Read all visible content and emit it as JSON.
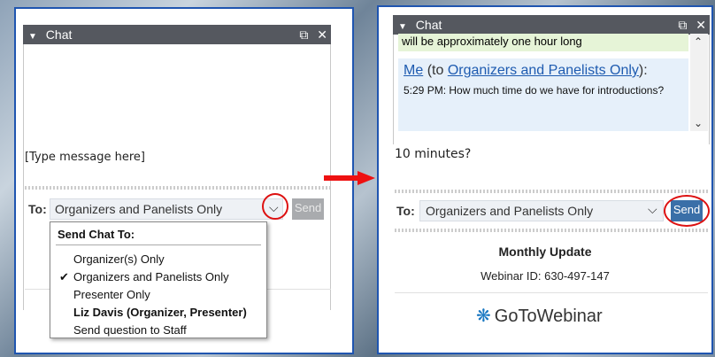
{
  "left_panel": {
    "title": "Chat",
    "message_placeholder": "[Type message here]",
    "to_label": "To:",
    "recipient_selected": "Organizers and Panelists Only",
    "send_label": "Send",
    "dropdown": {
      "header": "Send Chat To:",
      "items": [
        {
          "label": "Organizer(s) Only",
          "checked": false,
          "bold": false
        },
        {
          "label": "Organizers and Panelists Only",
          "checked": true,
          "bold": false
        },
        {
          "label": "Presenter Only",
          "checked": false,
          "bold": false
        },
        {
          "label": "Liz Davis (Organizer, Presenter)",
          "checked": false,
          "bold": true
        },
        {
          "label": "Send question to Staff",
          "checked": false,
          "bold": false
        }
      ]
    }
  },
  "right_panel": {
    "title": "Chat",
    "prev_message": "will be approximately one hour long",
    "message": {
      "sender": "Me",
      "to_prefix": "(to ",
      "recipient": "Organizers and Panelists Only",
      "suffix": "):",
      "time_text": "5:29 PM: How much time do we have for introductions?"
    },
    "input_value": "10 minutes?",
    "to_label": "To:",
    "recipient_selected": "Organizers and Panelists Only",
    "send_label": "Send",
    "webinar_title": "Monthly Update",
    "webinar_id": "Webinar ID: 630-497-147",
    "logo_text": "GoToWebinar"
  },
  "colors": {
    "accent_red": "#dd1111",
    "panel_border": "#1f55b0",
    "titlebar": "#55585f"
  },
  "icons": [
    "collapse-triangle-icon",
    "popout-icon",
    "close-icon",
    "chevron-down-icon",
    "checkmark-icon",
    "scroll-up-icon",
    "scroll-down-icon",
    "gotowebinar-logo-icon",
    "arrow-right-icon"
  ]
}
